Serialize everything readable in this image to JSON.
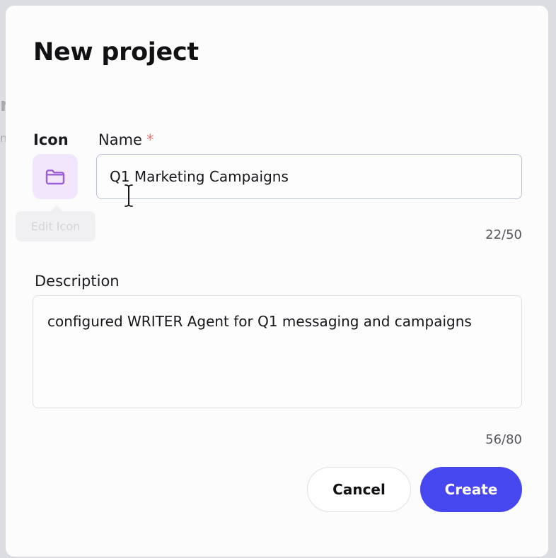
{
  "backdrop": {
    "fragment_1": "r",
    "fragment_2": "n"
  },
  "modal": {
    "title": "New project",
    "icon_section": {
      "label": "Icon",
      "icon": "folder-icon",
      "tooltip": "Edit Icon"
    },
    "name_field": {
      "label": "Name",
      "required_marker": "*",
      "value": "Q1 Marketing Campaigns",
      "counter": "22/50"
    },
    "description_field": {
      "label": "Description",
      "value": "configured WRITER Agent for Q1 messaging and campaigns",
      "counter": "56/80"
    },
    "buttons": {
      "cancel_label": "Cancel",
      "create_label": "Create"
    }
  },
  "colors": {
    "accent": "#4747f0",
    "icon_bg": "#f1e6fb",
    "icon_stroke": "#9b5ed6",
    "required": "#d97a7a",
    "backdrop": "#dcdde3"
  }
}
